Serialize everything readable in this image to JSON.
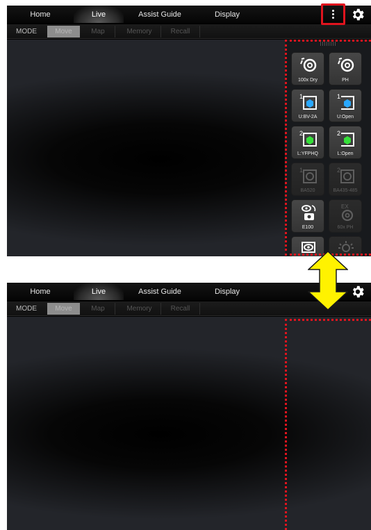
{
  "nav": {
    "tabs": [
      {
        "label": "Home"
      },
      {
        "label": "Live"
      },
      {
        "label": "Assist Guide"
      },
      {
        "label": "Display"
      }
    ],
    "menu_icon": "vertical-ellipsis-icon",
    "settings_icon": "gear-icon"
  },
  "mode_bar": {
    "label": "MODE",
    "options": [
      {
        "label": "Move",
        "selected": true
      },
      {
        "label": "Map"
      },
      {
        "label": "Memory"
      },
      {
        "label": "Recall"
      }
    ]
  },
  "panel": {
    "tiles": [
      {
        "label": "100x Dry",
        "icon": "objective-icon",
        "enabled": true
      },
      {
        "label": "PH",
        "icon": "objective-icon",
        "enabled": true
      },
      {
        "label": "U:BV-2A",
        "icon": "filter-cube-blue-icon",
        "enabled": true
      },
      {
        "label": "U:Open",
        "icon": "filter-cube-blue-icon",
        "enabled": true
      },
      {
        "label": "L:YFPHQ",
        "icon": "filter-cube-green-icon",
        "enabled": true
      },
      {
        "label": "L:Open",
        "icon": "filter-cube-green-icon",
        "enabled": true
      },
      {
        "label": "BA520",
        "icon": "filter-icon",
        "enabled": false
      },
      {
        "label": "BA435-485",
        "icon": "filter-icon",
        "enabled": false
      },
      {
        "label": "E100",
        "icon": "eyepiece-camera-icon",
        "enabled": true
      },
      {
        "label": "60x PH",
        "icon": "ex-objective-icon",
        "enabled": false
      },
      {
        "label": "",
        "icon": "eye-icon",
        "enabled": true
      },
      {
        "label": "",
        "icon": "light-icon",
        "enabled": false
      }
    ]
  },
  "colors": {
    "highlight": "#e0141e",
    "arrow": "#fff200",
    "cube_blue": "#29a8ff",
    "cube_green": "#36e03a"
  }
}
